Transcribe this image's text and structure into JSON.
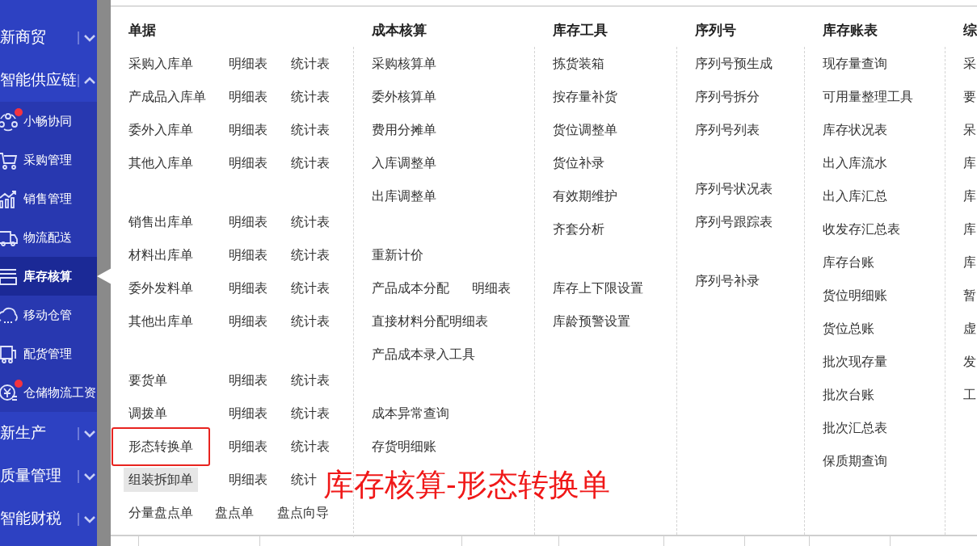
{
  "sidebar": {
    "groups": [
      {
        "label": "新商贸",
        "expanded": false
      },
      {
        "label": "智能供应链",
        "expanded": true,
        "children": [
          {
            "label": "小畅协同",
            "notification_dot": true,
            "selected": false
          },
          {
            "label": "采购管理",
            "notification_dot": false,
            "selected": false
          },
          {
            "label": "销售管理",
            "notification_dot": false,
            "selected": false
          },
          {
            "label": "物流配送",
            "notification_dot": false,
            "selected": false
          },
          {
            "label": "库存核算",
            "notification_dot": false,
            "selected": true
          },
          {
            "label": "移动仓管",
            "notification_dot": false,
            "selected": false
          },
          {
            "label": "配货管理",
            "notification_dot": false,
            "selected": false
          },
          {
            "label": "仓储物流工资",
            "notification_dot": true,
            "selected": false
          }
        ]
      },
      {
        "label": "新生产",
        "expanded": false
      },
      {
        "label": "质量管理",
        "expanded": false
      },
      {
        "label": "智能财税",
        "expanded": false
      }
    ]
  },
  "menu": {
    "columns": [
      {
        "title": "单据",
        "rows": [
          {
            "kind": "report",
            "cells": [
              "采购入库单",
              "明细表",
              "统计表"
            ],
            "hovered": false,
            "highlighted": false
          },
          {
            "kind": "report",
            "cells": [
              "产成品入库单",
              "明细表",
              "统计表"
            ],
            "hovered": false,
            "highlighted": false
          },
          {
            "kind": "report",
            "cells": [
              "委外入库单",
              "明细表",
              "统计表"
            ],
            "hovered": false,
            "highlighted": false
          },
          {
            "kind": "report",
            "cells": [
              "其他入库单",
              "明细表",
              "统计表"
            ],
            "hovered": false,
            "highlighted": false
          },
          {
            "kind": "spacer"
          },
          {
            "kind": "report",
            "cells": [
              "销售出库单",
              "明细表",
              "统计表"
            ],
            "hovered": false,
            "highlighted": false
          },
          {
            "kind": "report",
            "cells": [
              "材料出库单",
              "明细表",
              "统计表"
            ],
            "hovered": false,
            "highlighted": false
          },
          {
            "kind": "report",
            "cells": [
              "委外发料单",
              "明细表",
              "统计表"
            ],
            "hovered": false,
            "highlighted": false
          },
          {
            "kind": "report",
            "cells": [
              "其他出库单",
              "明细表",
              "统计表"
            ],
            "hovered": false,
            "highlighted": false
          },
          {
            "kind": "spacer"
          },
          {
            "kind": "report",
            "cells": [
              "要货单",
              "明细表",
              "统计表"
            ],
            "hovered": false,
            "highlighted": false
          },
          {
            "kind": "report",
            "cells": [
              "调拨单",
              "明细表",
              "统计表"
            ],
            "hovered": false,
            "highlighted": false
          },
          {
            "kind": "report",
            "cells": [
              "形态转换单",
              "明细表",
              "统计表"
            ],
            "hovered": false,
            "highlighted": true
          },
          {
            "kind": "report",
            "cells": [
              "组装拆卸单",
              "明细表",
              "统计"
            ],
            "hovered": true,
            "highlighted": false
          },
          {
            "kind": "tools",
            "cells": [
              "分量盘点单",
              "盘点单",
              "盘点向导"
            ],
            "hovered": false,
            "highlighted": false
          }
        ]
      },
      {
        "title": "成本核算",
        "rows": [
          {
            "kind": "item",
            "cells": [
              "采购核算单"
            ]
          },
          {
            "kind": "item",
            "cells": [
              "委外核算单"
            ]
          },
          {
            "kind": "item",
            "cells": [
              "费用分摊单"
            ]
          },
          {
            "kind": "item",
            "cells": [
              "入库调整单"
            ]
          },
          {
            "kind": "item",
            "cells": [
              "出库调整单"
            ]
          },
          {
            "kind": "spacer"
          },
          {
            "kind": "item",
            "cells": [
              "重新计价"
            ]
          },
          {
            "kind": "pair",
            "cells": [
              "产品成本分配",
              "明细表"
            ]
          },
          {
            "kind": "item",
            "cells": [
              "直接材料分配明细表"
            ]
          },
          {
            "kind": "item",
            "cells": [
              "产品成本录入工具"
            ]
          },
          {
            "kind": "spacer"
          },
          {
            "kind": "item",
            "cells": [
              "成本异常查询"
            ]
          },
          {
            "kind": "item",
            "cells": [
              "存货明细账"
            ]
          }
        ]
      },
      {
        "title": "库存工具",
        "rows": [
          {
            "kind": "item",
            "cells": [
              "拣货装箱"
            ]
          },
          {
            "kind": "item",
            "cells": [
              "按存量补货"
            ]
          },
          {
            "kind": "item",
            "cells": [
              "货位调整单"
            ]
          },
          {
            "kind": "item",
            "cells": [
              "货位补录"
            ]
          },
          {
            "kind": "item",
            "cells": [
              "有效期维护"
            ]
          },
          {
            "kind": "item",
            "cells": [
              "齐套分析"
            ]
          },
          {
            "kind": "spacer"
          },
          {
            "kind": "item",
            "cells": [
              "库存上下限设置"
            ]
          },
          {
            "kind": "item",
            "cells": [
              "库龄预警设置"
            ]
          }
        ]
      },
      {
        "title": "序列号",
        "rows": [
          {
            "kind": "item",
            "cells": [
              "序列号预生成"
            ]
          },
          {
            "kind": "item",
            "cells": [
              "序列号拆分"
            ]
          },
          {
            "kind": "item",
            "cells": [
              "序列号列表"
            ]
          },
          {
            "kind": "spacer"
          },
          {
            "kind": "item",
            "cells": [
              "序列号状况表"
            ]
          },
          {
            "kind": "item",
            "cells": [
              "序列号跟踪表"
            ]
          },
          {
            "kind": "spacer"
          },
          {
            "kind": "item",
            "cells": [
              "序列号补录"
            ]
          }
        ]
      },
      {
        "title": "库存账表",
        "rows": [
          {
            "kind": "item",
            "cells": [
              "现存量查询"
            ]
          },
          {
            "kind": "item",
            "cells": [
              "可用量整理工具"
            ]
          },
          {
            "kind": "item",
            "cells": [
              "库存状况表"
            ]
          },
          {
            "kind": "item",
            "cells": [
              "出入库流水"
            ]
          },
          {
            "kind": "item",
            "cells": [
              "出入库汇总"
            ]
          },
          {
            "kind": "item",
            "cells": [
              "收发存汇总表"
            ]
          },
          {
            "kind": "item",
            "cells": [
              "库存台账"
            ]
          },
          {
            "kind": "item",
            "cells": [
              "货位明细账"
            ]
          },
          {
            "kind": "item",
            "cells": [
              "货位总账"
            ]
          },
          {
            "kind": "item",
            "cells": [
              "批次现存量"
            ]
          },
          {
            "kind": "item",
            "cells": [
              "批次台账"
            ]
          },
          {
            "kind": "item",
            "cells": [
              "批次汇总表"
            ]
          },
          {
            "kind": "item",
            "cells": [
              "保质期查询"
            ]
          }
        ]
      },
      {
        "title": "综",
        "rows": [
          {
            "kind": "item",
            "cells": [
              "采"
            ]
          },
          {
            "kind": "item",
            "cells": [
              "要"
            ]
          },
          {
            "kind": "item",
            "cells": [
              "呆"
            ]
          },
          {
            "kind": "item",
            "cells": [
              "库"
            ]
          },
          {
            "kind": "item",
            "cells": [
              "库"
            ]
          },
          {
            "kind": "item",
            "cells": [
              "库"
            ]
          },
          {
            "kind": "item",
            "cells": [
              "库"
            ]
          },
          {
            "kind": "item",
            "cells": [
              "暂"
            ]
          },
          {
            "kind": "item",
            "cells": [
              "虚"
            ]
          },
          {
            "kind": "item",
            "cells": [
              "发"
            ]
          },
          {
            "kind": "item",
            "cells": [
              "工"
            ]
          }
        ]
      }
    ]
  },
  "annotation": {
    "text": "库存核算-形态转换单"
  }
}
